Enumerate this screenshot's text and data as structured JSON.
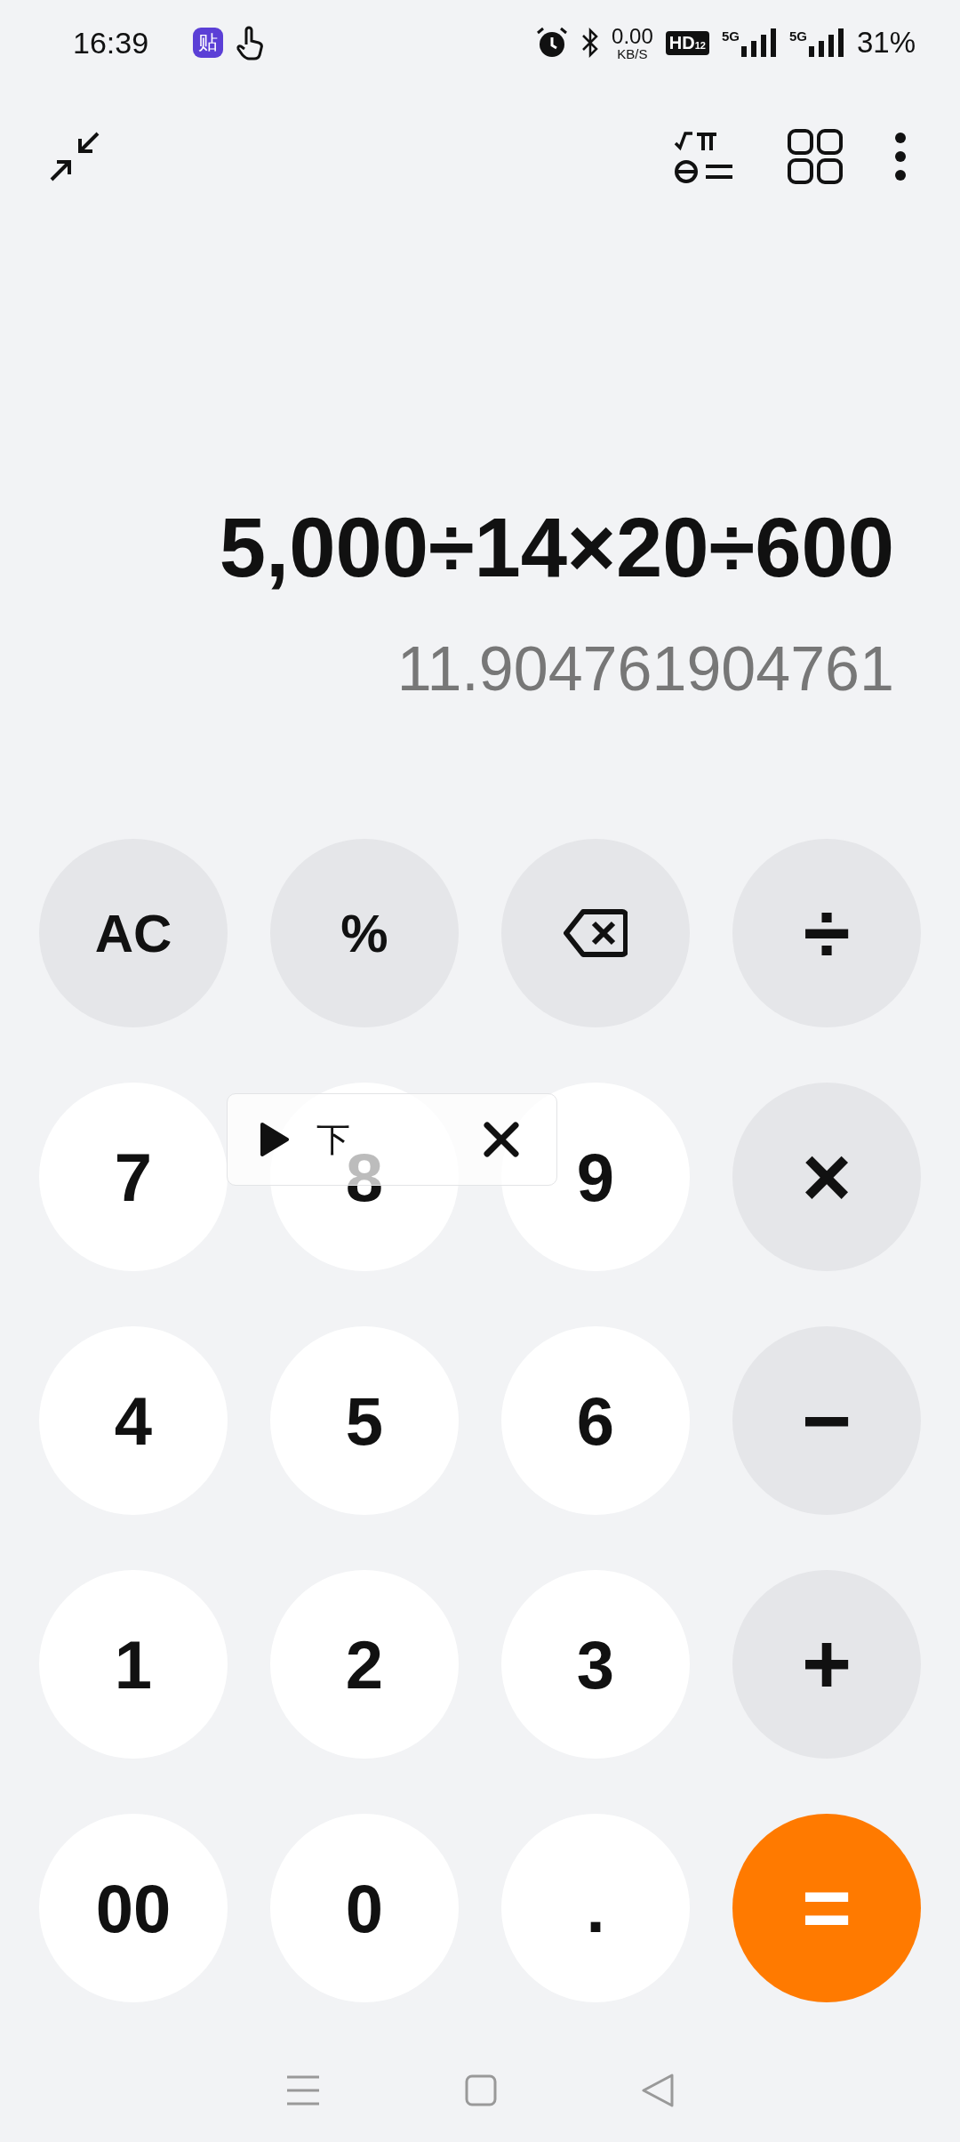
{
  "status_bar": {
    "time": "16:39",
    "app_badge": "贴",
    "net_speed": "0.00",
    "net_unit": "KB/S",
    "hd": "HD",
    "hd_sub": "12",
    "sim": [
      "5G",
      "5G"
    ],
    "battery": "31%"
  },
  "display": {
    "expression": "5,000÷14×20÷600",
    "result": "11.904761904761"
  },
  "keys": [
    {
      "kind": "function",
      "label": "AC"
    },
    {
      "kind": "function",
      "label": "%"
    },
    {
      "kind": "backspace"
    },
    {
      "kind": "operator",
      "label": "÷"
    },
    {
      "kind": "digit",
      "label": "7"
    },
    {
      "kind": "digit",
      "label": "8"
    },
    {
      "kind": "digit",
      "label": "9"
    },
    {
      "kind": "operator",
      "label": "×"
    },
    {
      "kind": "digit",
      "label": "4"
    },
    {
      "kind": "digit",
      "label": "5"
    },
    {
      "kind": "digit",
      "label": "6"
    },
    {
      "kind": "operator",
      "label": "−"
    },
    {
      "kind": "digit",
      "label": "1"
    },
    {
      "kind": "digit",
      "label": "2"
    },
    {
      "kind": "digit",
      "label": "3"
    },
    {
      "kind": "operator",
      "label": "+"
    },
    {
      "kind": "digit",
      "label": "00"
    },
    {
      "kind": "digit",
      "label": "0"
    },
    {
      "kind": "digit",
      "label": "."
    },
    {
      "kind": "equals",
      "label": "="
    }
  ],
  "floating_player": {
    "text": "下"
  }
}
